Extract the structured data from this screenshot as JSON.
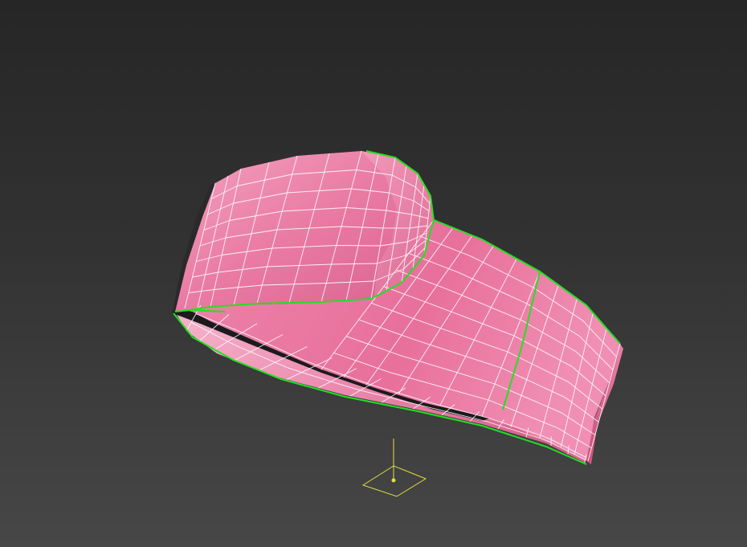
{
  "viewport": {
    "view": "perspective",
    "shading": "smooth-with-wireframe-edges"
  },
  "object": {
    "type": "editable-poly-mesh",
    "shape": "folded-band-strap",
    "selected": true,
    "colors": {
      "material": "#e8729c",
      "material_light": "#f59cbd",
      "material_dark": "#c4507a",
      "wire": "#ffffff",
      "selection_outline": "#22e022",
      "backface": "#111111"
    }
  },
  "pivot_gizmo": {
    "visible": true,
    "color": "#e0e040"
  }
}
